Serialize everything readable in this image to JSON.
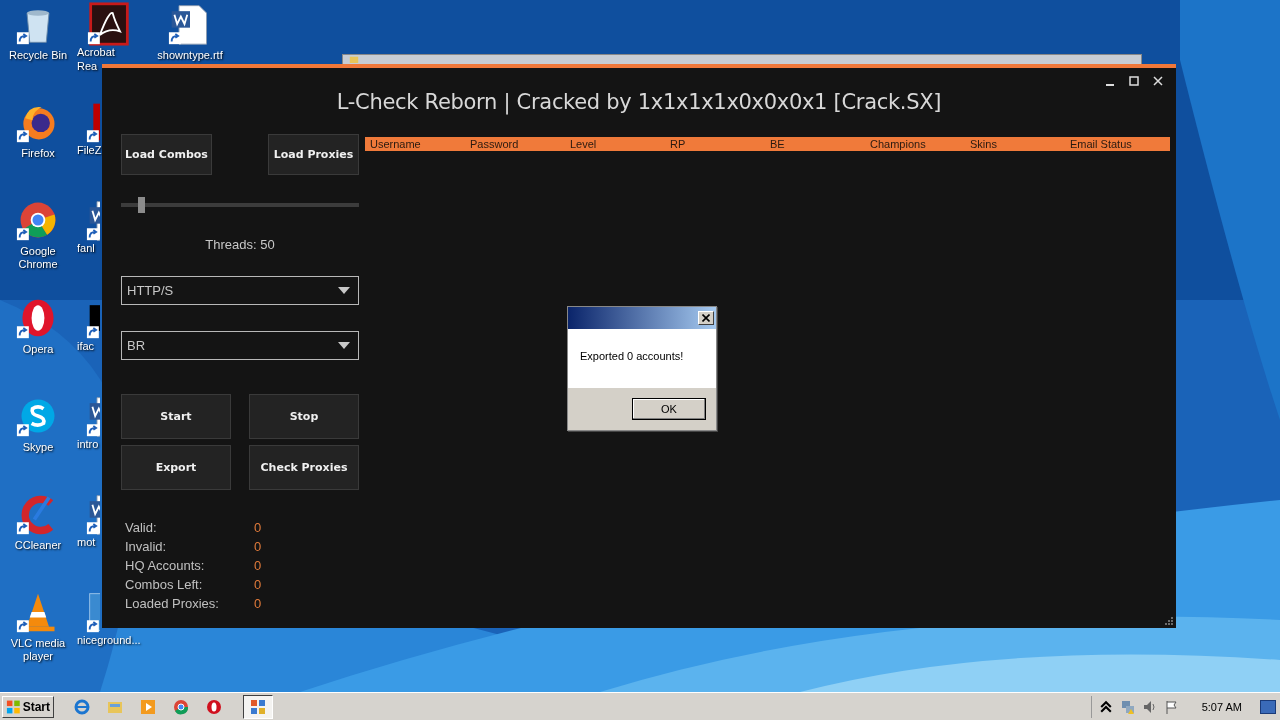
{
  "desktop": {
    "columns": [
      {
        "icons": [
          {
            "label": "Recycle Bin",
            "kind": "recycle"
          },
          {
            "label": "Firefox",
            "kind": "firefox"
          },
          {
            "label": "Google Chrome",
            "kind": "chrome"
          },
          {
            "label": "Opera",
            "kind": "opera"
          },
          {
            "label": "Skype",
            "kind": "skype"
          },
          {
            "label": "CCleaner",
            "kind": "ccleaner"
          },
          {
            "label": "VLC media player",
            "kind": "vlc"
          }
        ]
      },
      {
        "icons": [
          {
            "label": "Acrobat",
            "label_2": "Rea",
            "kind": "acrobat"
          },
          {
            "label": "FileZ",
            "kind": "filezilla"
          },
          {
            "label": "fanl",
            "kind": "word"
          },
          {
            "label": "ifac",
            "kind": "black"
          },
          {
            "label": "intro",
            "kind": "word"
          },
          {
            "label": "mot",
            "kind": "word"
          },
          {
            "label": "niceground...",
            "kind": "blank"
          }
        ]
      },
      {
        "icons": [
          {
            "label": "showntype.rtf",
            "kind": "word"
          }
        ]
      }
    ]
  },
  "app": {
    "title": "L-Check Reborn | Cracked by 1x1x1x1x0x0x0x1 [Crack.SX]",
    "load_buttons": [
      "Load Combos",
      "Load Proxies"
    ],
    "threads_slider": {
      "level": 0.07
    },
    "threads_label": "Threads: 50",
    "dropdowns": [
      {
        "value": "HTTP/S"
      },
      {
        "value": "BR"
      }
    ],
    "action_buttons": [
      "Start",
      "Stop",
      "Export",
      "Check Proxies"
    ],
    "stats": [
      {
        "label": "Valid:",
        "value": "0"
      },
      {
        "label": "Invalid:",
        "value": "0"
      },
      {
        "label": "HQ Accounts:",
        "value": "0"
      },
      {
        "label": "Combos Left:",
        "value": "0"
      },
      {
        "label": "Loaded Proxies:",
        "value": "0"
      }
    ],
    "table": {
      "columns": [
        "Username",
        "Password",
        "Level",
        "RP",
        "BE",
        "Champions",
        "Skins",
        "Email Status"
      ]
    }
  },
  "dialog": {
    "message": "Exported 0 accounts!",
    "button": "OK"
  },
  "taskbar": {
    "start": "Start",
    "apps": [
      {
        "kind": "ie",
        "selected": false
      },
      {
        "kind": "explorer",
        "selected": false
      },
      {
        "kind": "media",
        "selected": false
      },
      {
        "kind": "chrome",
        "selected": false
      },
      {
        "kind": "opera",
        "selected": false
      },
      {
        "kind": "app",
        "selected": true
      }
    ],
    "clock": "5:07 AM"
  }
}
